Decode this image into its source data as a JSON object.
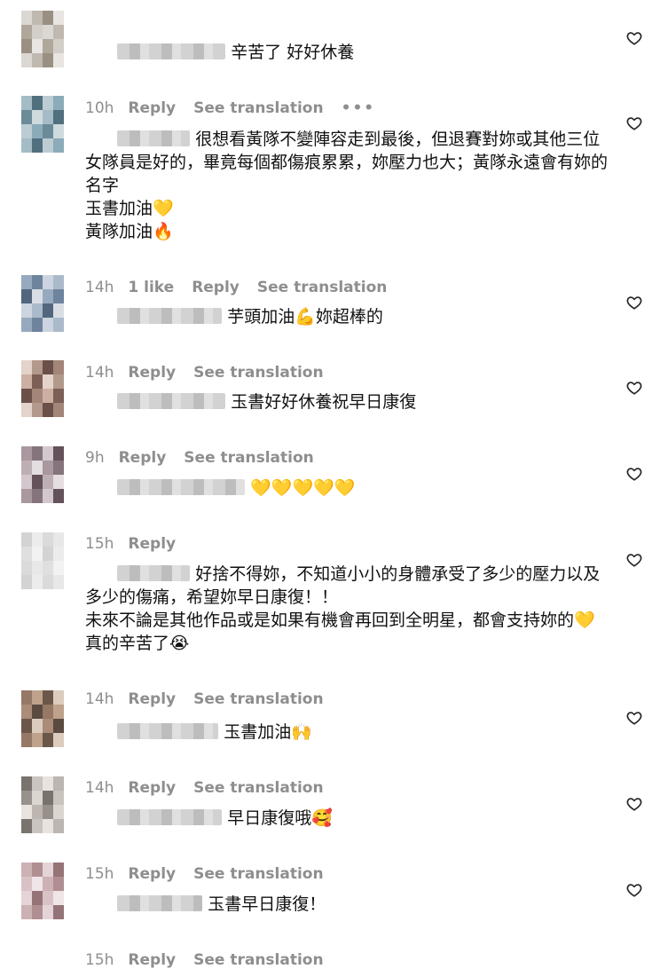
{
  "comments": [
    {
      "text": "辛苦了 好好休養",
      "time": "10h",
      "likes": "",
      "reply": "Reply",
      "translate": "See translation",
      "more": "•••"
    },
    {
      "text": "很想看黃隊不變陣容走到最後，但退賽對妳或其他三位女隊員是好的，畢竟每個都傷痕累累，妳壓力也大；黃隊永遠會有妳的名字\n玉書加油💛\n黃隊加油🔥",
      "time": "14h",
      "likes": "1 like",
      "reply": "Reply",
      "translate": "See translation"
    },
    {
      "text": "芋頭加油💪妳超棒的",
      "time": "14h",
      "likes": "",
      "reply": "Reply",
      "translate": "See translation"
    },
    {
      "text": "玉書好好休養祝早日康復",
      "time": "9h",
      "likes": "",
      "reply": "Reply",
      "translate": "See translation"
    },
    {
      "text": "💛💛💛💛💛",
      "time": "15h",
      "likes": "",
      "reply": "Reply",
      "translate": ""
    },
    {
      "text": "好捨不得妳，不知道小小的身體承受了多少的壓力以及多少的傷痛，希望妳早日康復！！\n未來不論是其他作品或是如果有機會再回到全明星，都會支持妳的💛真的辛苦了😭",
      "time": "14h",
      "likes": "",
      "reply": "Reply",
      "translate": "See translation"
    },
    {
      "text": "玉書加油🙌",
      "time": "14h",
      "likes": "",
      "reply": "Reply",
      "translate": "See translation"
    },
    {
      "text": "早日康復哦🥰",
      "time": "15h",
      "likes": "",
      "reply": "Reply",
      "translate": "See translation"
    },
    {
      "text": "玉書早日康復！",
      "time": "15h",
      "likes": "",
      "reply": "Reply",
      "translate": "See translation"
    }
  ],
  "icons": {
    "like": "heart-outline-icon",
    "avatar": "pixelated-avatar",
    "more": "ellipsis-icon"
  },
  "colors": {
    "meta": "#8e8e8e",
    "text": "#111111",
    "background": "#ffffff"
  }
}
